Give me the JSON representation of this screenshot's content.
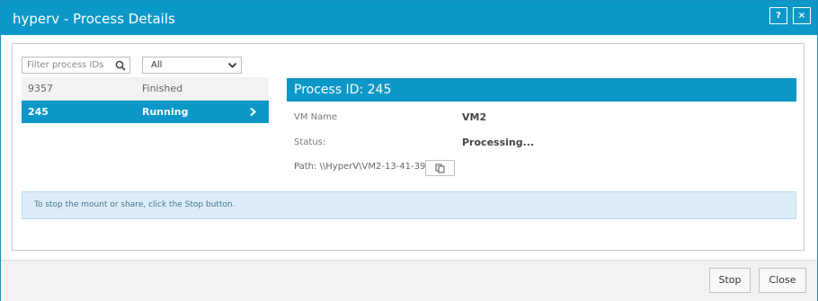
{
  "window": {
    "title": "hyperv - Process Details",
    "help_label": "?",
    "close_label": "×"
  },
  "filter": {
    "placeholder": "Filter process IDs",
    "select_value": "All"
  },
  "processes": [
    {
      "id": "9357",
      "status": "Finished"
    },
    {
      "id": "245",
      "status": "Running"
    }
  ],
  "detail": {
    "header": "Process ID: 245",
    "vm_name_label": "VM Name",
    "vm_name_value": "VM2",
    "status_label": "Status:",
    "status_value": "Processing...",
    "path_text": "Path: \\\\HyperV\\VM2-13-41-39"
  },
  "info": {
    "message": "To stop the mount or share, click the Stop button."
  },
  "footer": {
    "stop_label": "Stop",
    "close_label": "Close"
  },
  "colors": {
    "accent": "#0b98c8",
    "info_bg": "#dcedf7"
  },
  "icons": [
    "help-icon",
    "close-icon",
    "search-icon",
    "chevron-down-icon",
    "chevron-right-icon",
    "copy-icon"
  ]
}
